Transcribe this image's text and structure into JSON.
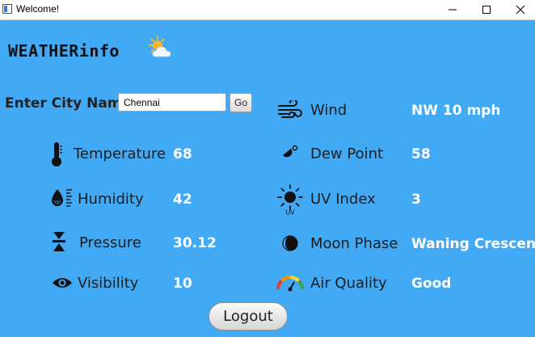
{
  "window": {
    "title": "Welcome!"
  },
  "app": {
    "logo_text": "WEATHERinfo"
  },
  "search": {
    "label": "Enter City Name",
    "value": "Chennai",
    "go_label": "Go"
  },
  "metrics": {
    "temperature": {
      "label": "Temperature",
      "value": "68",
      "icon": "thermometer-icon"
    },
    "humidity": {
      "label": "Humidity",
      "value": "42",
      "icon": "humidity-icon"
    },
    "pressure": {
      "label": "Pressure",
      "value": "30.12",
      "icon": "pressure-icon"
    },
    "visibility": {
      "label": "Visibility",
      "value": "10",
      "icon": "eye-icon"
    },
    "wind": {
      "label": "Wind",
      "value": "NW 10 mph",
      "icon": "wind-icon"
    },
    "dew_point": {
      "label": "Dew Point",
      "value": "58",
      "icon": "dew-point-icon"
    },
    "uv_index": {
      "label": "UV Index",
      "value": "3",
      "icon": "uv-sun-icon"
    },
    "moon_phase": {
      "label": "Moon Phase",
      "value": "Waning Crescent",
      "icon": "moon-phase-icon"
    },
    "air_quality": {
      "label": "Air Quality",
      "value": "Good",
      "icon": "air-quality-gauge-icon"
    }
  },
  "actions": {
    "logout_label": "Logout"
  },
  "colors": {
    "background": "#42a9f5",
    "value_text": "#ffffff"
  }
}
